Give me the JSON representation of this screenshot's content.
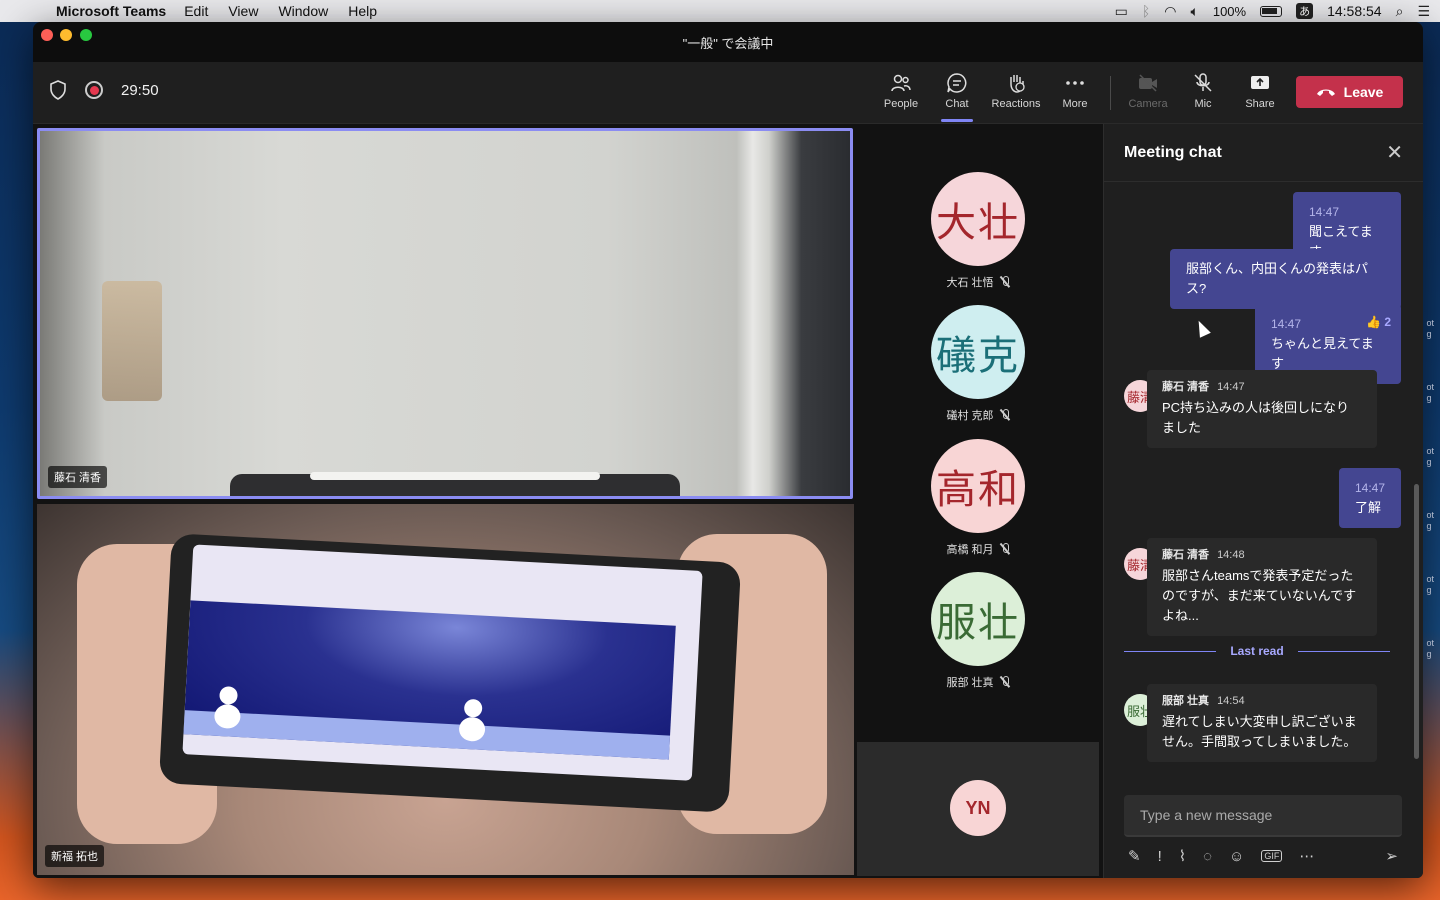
{
  "menubar": {
    "apple": "",
    "app_name": "Microsoft Teams",
    "menus": [
      "Edit",
      "View",
      "Window",
      "Help"
    ],
    "battery": "100%",
    "ime": "あ",
    "clock": "14:58:54"
  },
  "window": {
    "title": "\"一般\" で会議中"
  },
  "toolbar": {
    "timer": "29:50",
    "buttons": {
      "people": "People",
      "chat": "Chat",
      "reactions": "Reactions",
      "more": "More",
      "camera": "Camera",
      "mic": "Mic",
      "share": "Share"
    },
    "leave": "Leave"
  },
  "video": {
    "tile1_name": "藤石 清香",
    "tile2_name": "新福 拓也"
  },
  "roster": [
    {
      "initials": "大壮",
      "name": "大石 壮悟",
      "bg": "#f6d6da",
      "fg": "#a4262c"
    },
    {
      "initials": "礒克",
      "name": "礒村 克郎",
      "bg": "#cfeef0",
      "fg": "#1b6f78"
    },
    {
      "initials": "高和",
      "name": "高橋 和月",
      "bg": "#f8d5d5",
      "fg": "#a4262c"
    },
    {
      "initials": "服壮",
      "name": "服部 壮真",
      "bg": "#dcefd8",
      "fg": "#3a6b35"
    }
  ],
  "yn_initials": "YN",
  "chat": {
    "title": "Meeting chat",
    "messages": {
      "m1_time": "14:47",
      "m1_text": "聞こえてます",
      "m2_text": "服部くん、内田くんの発表はパス?",
      "m3_time": "14:47",
      "m3_react": "👍 2",
      "m3_text": "ちゃんと見えてます",
      "m4_author": "藤石 清香",
      "m4_time": "14:47",
      "m4_text": "PC持ち込みの人は後回しになりました",
      "m4_avatar": "藤清",
      "m5_time": "14:47",
      "m5_text": "了解",
      "m6_author": "藤石 清香",
      "m6_time": "14:48",
      "m6_text": "服部さんteamsで発表予定だったのですが、まだ来ていないんですよね...",
      "m6_avatar": "藤清",
      "m7_author": "服部 壮真",
      "m7_time": "14:54",
      "m7_text": "遅れてしまい大変申し訳ございません。手間取ってしまいました。",
      "m7_avatar": "服壮"
    },
    "last_read": "Last read",
    "compose_placeholder": "Type a new message"
  },
  "desktop_edge_labels": [
    "ot\ng",
    "ot\ng",
    "ot\ng",
    "ot\ng",
    "ot\ng",
    "ot\ng"
  ]
}
